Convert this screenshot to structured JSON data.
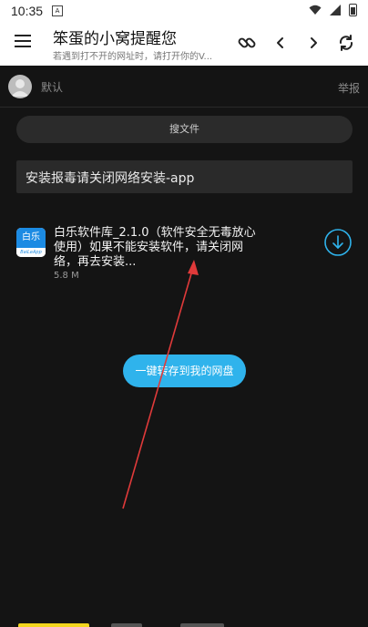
{
  "status_bar": {
    "time": "10:35",
    "notification_icon": "A"
  },
  "toolbar": {
    "title": "笨蛋的小窝提醒您",
    "subtitle": "若遇到打不开的网址时，请打开你的V...",
    "icons": [
      "menu-icon",
      "link-icon",
      "back-icon",
      "forward-icon",
      "refresh-icon"
    ]
  },
  "user": {
    "name": "默认",
    "report_label": "举报"
  },
  "search": {
    "label": "搜文件"
  },
  "notice": {
    "text": "安装报毒请关闭网络安装-app"
  },
  "file": {
    "name": "白乐软件库_2.1.0（软件安全无毒放心使用）如果不能安装软件，请关闭网络，再去安装...",
    "size": "5.8 M",
    "icon_text_top": "白乐",
    "icon_text_bottom": "BaiLeApp"
  },
  "actions": {
    "save_label": "一键转存到我的网盘"
  },
  "colors": {
    "accent": "#2fb3ec",
    "icon_blue": "#1c8be3",
    "annotation": "#e03a3a"
  }
}
